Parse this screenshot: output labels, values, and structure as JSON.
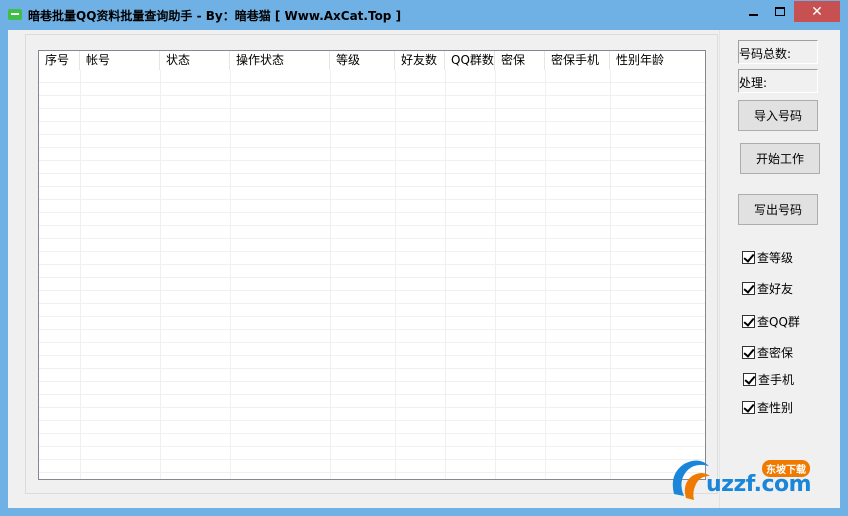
{
  "window": {
    "title": "暗巷批量QQ资料批量查询助手 - By：暗巷猫 [ Www.AxCat.Top ]",
    "close_glyph": "✕"
  },
  "listview": {
    "columns": [
      "序号",
      "帐号",
      "状态",
      "操作状态",
      "等级",
      "好友数",
      "QQ群数",
      "密保",
      "密保手机",
      "性别年龄"
    ]
  },
  "sidebar": {
    "total_label": "号码总数:",
    "processed_label": "处理:",
    "import_button": "导入号码",
    "start_button": "开始工作",
    "export_button": "写出号码",
    "checks": [
      {
        "label": "查等级",
        "checked": true
      },
      {
        "label": "查好友",
        "checked": true
      },
      {
        "label": "查QQ群",
        "checked": true
      },
      {
        "label": "查密保",
        "checked": true
      },
      {
        "label": "查手机",
        "checked": true
      },
      {
        "label": "查性别",
        "checked": true
      }
    ]
  },
  "watermark": {
    "brand": "uzzf.com",
    "tag": "东坡下载"
  },
  "colors": {
    "titlebar": "#6fb1e4",
    "close_button": "#c75050",
    "watermark_blue": "#1a86d9",
    "watermark_orange": "#f07a00"
  }
}
